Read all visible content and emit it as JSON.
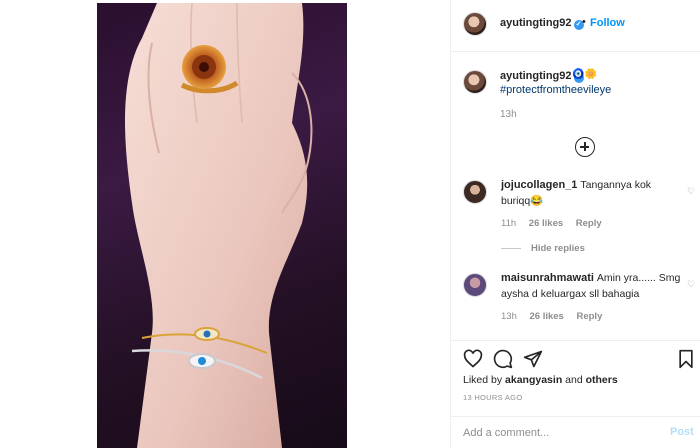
{
  "post": {
    "username": "ayutingting92",
    "follow_label": "Follow",
    "separator": "•",
    "verified_mark": "✓"
  },
  "caption": {
    "username": "ayutingting92",
    "emoji": "🧿🌼",
    "hashtag": "#protectfromtheevileye",
    "time": "13h"
  },
  "comments": [
    {
      "username": "jojucollagen_1",
      "text": "Tangannya kok buriqq😂",
      "time": "11h",
      "likes": "26 likes",
      "reply": "Reply"
    },
    {
      "username": "maisunrahmawati",
      "text": "Amin yra...... Smg aysha d keluargax sll bahagia",
      "time": "13h",
      "likes": "26 likes",
      "reply": "Reply"
    }
  ],
  "hide_replies": "Hide replies",
  "likes": {
    "prefix": "Liked by",
    "user": "akangyasin",
    "conjunction": "and",
    "others": "others"
  },
  "post_time": "13 HOURS AGO",
  "add_comment": {
    "placeholder": "Add a comment...",
    "post_label": "Post"
  },
  "icons": {
    "like": "heart-icon",
    "comment": "comment-icon",
    "share": "share-icon",
    "save": "bookmark-icon",
    "load_more": "plus-circle-icon"
  },
  "colors": {
    "link_blue": "#0095f6",
    "hashtag": "#00376b",
    "muted": "#8e8e8e",
    "post_disabled": "#b2dffc"
  }
}
